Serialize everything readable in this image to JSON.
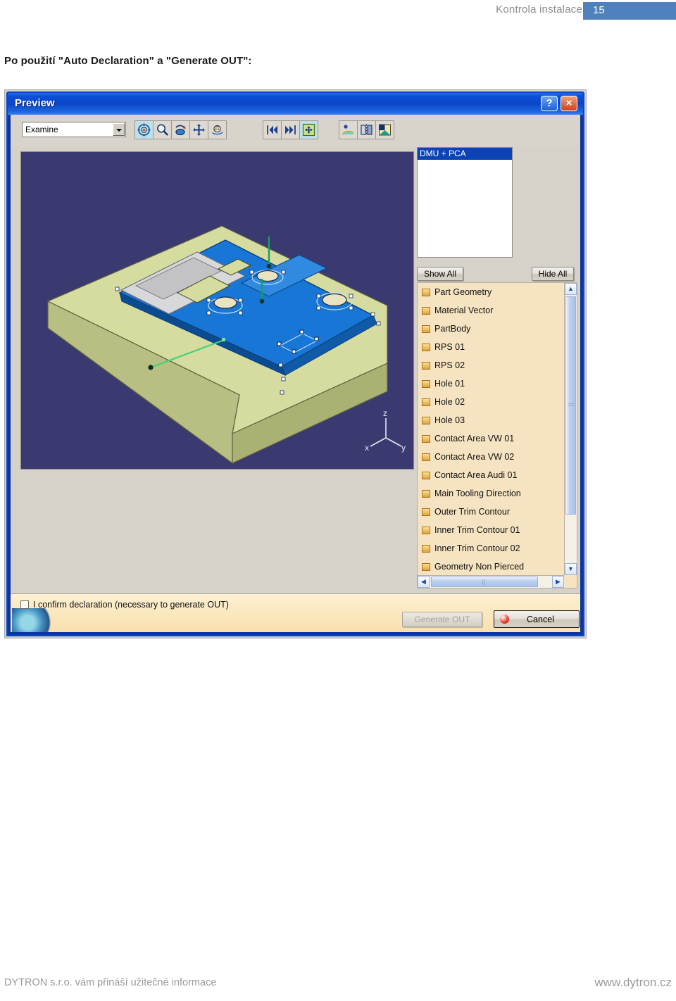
{
  "page": {
    "header_title": "Kontrola instalace",
    "page_number": "15",
    "badge_color": "#4f81bd",
    "intro_text": "Po použití \"Auto Declaration\" a \"Generate OUT\":"
  },
  "dialog": {
    "title": "Preview",
    "titlebar_buttons": [
      {
        "name": "help-button",
        "glyph": "?"
      },
      {
        "name": "close-button",
        "glyph": "×"
      }
    ],
    "toolbar": {
      "mode_select": {
        "value": "Examine",
        "options": [
          "Examine"
        ]
      },
      "groups": [
        {
          "buttons": [
            {
              "name": "fit-target-icon",
              "selected": true
            },
            {
              "name": "zoom-magnifier-icon",
              "selected": false
            },
            {
              "name": "rotate-view-icon",
              "selected": false
            },
            {
              "name": "pan-move-icon",
              "selected": false
            },
            {
              "name": "turntable-icon",
              "selected": false
            }
          ]
        },
        {
          "buttons": [
            {
              "name": "first-step-icon",
              "selected": false
            },
            {
              "name": "last-step-icon",
              "selected": false
            },
            {
              "name": "fit-all-icon",
              "selected": true
            }
          ]
        },
        {
          "buttons": [
            {
              "name": "shading-icon",
              "selected": false
            },
            {
              "name": "mirror-icon",
              "selected": false
            },
            {
              "name": "render-mode-icon",
              "selected": false
            }
          ]
        }
      ]
    },
    "viewport": {
      "background_color": "#3a3a70",
      "axis_labels": {
        "x": "x",
        "y": "y",
        "z": "z"
      }
    },
    "tree": {
      "selected_item": "DMU + PCA",
      "items": [
        "DMU + PCA"
      ]
    },
    "buttons": {
      "show_all": "Show All",
      "hide_all": "Hide All",
      "generate_out": "Generate OUT",
      "cancel": "Cancel"
    },
    "feature_list": [
      "Part Geometry",
      "Material Vector",
      "PartBody",
      "RPS 01",
      "RPS 02",
      "Hole 01",
      "Hole 02",
      "Hole 03",
      "Contact Area VW 01",
      "Contact Area VW 02",
      "Contact Area Audi 01",
      "Main Tooling Direction",
      "Outer Trim Contour",
      "Inner Trim Contour 01",
      "Inner Trim Contour 02",
      "Geometry Non Pierced"
    ],
    "confirm_checkbox": {
      "label": "I confirm declaration (necessary to generate OUT)",
      "checked": false
    }
  },
  "footer": {
    "left_text": "DYTRON s.r.o. vám přináší užitečné informace",
    "right_text": "www.dytron.cz"
  }
}
